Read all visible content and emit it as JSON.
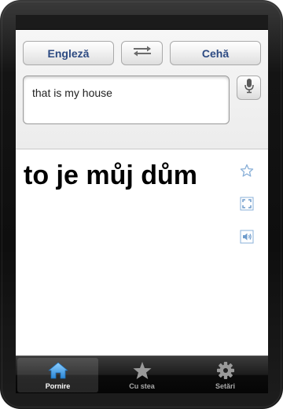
{
  "header": {
    "source_language": "Engleză",
    "target_language": "Cehă"
  },
  "input": {
    "value": "that is my house"
  },
  "result": {
    "translation": "to je můj dům"
  },
  "tabs": [
    {
      "label": "Pornire",
      "icon": "home-icon",
      "active": true
    },
    {
      "label": "Cu stea",
      "icon": "star-icon",
      "active": false
    },
    {
      "label": "Setări",
      "icon": "gear-icon",
      "active": false
    }
  ],
  "colors": {
    "accent_blue": "#2c4a82",
    "active_tab_blue": "#3d9de3"
  }
}
